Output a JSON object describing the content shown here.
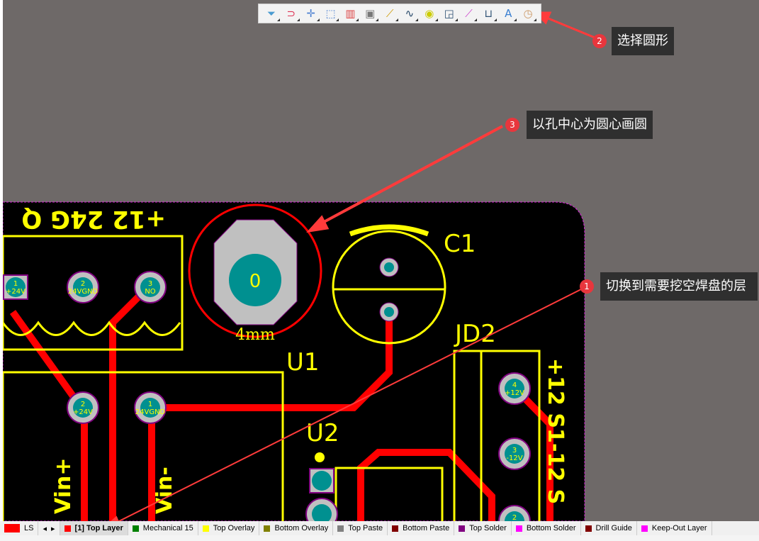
{
  "toolbar": {
    "items": [
      {
        "icon": "filter-icon",
        "glyph": "⏷",
        "color": "#4a9bd1"
      },
      {
        "icon": "magnet-icon",
        "glyph": "⊃",
        "color": "#d35"
      },
      {
        "icon": "move-icon",
        "glyph": "✛",
        "color": "#4a7fd1"
      },
      {
        "icon": "select-rect-icon",
        "glyph": "⬚",
        "color": "#4a7fd1"
      },
      {
        "icon": "align-icon",
        "glyph": "▥",
        "color": "#d44"
      },
      {
        "icon": "component-icon",
        "glyph": "▣",
        "color": "#777"
      },
      {
        "icon": "route-track-icon",
        "glyph": "⟋",
        "color": "#c90"
      },
      {
        "icon": "interactive-route-icon",
        "glyph": "∿",
        "color": "#246"
      },
      {
        "icon": "via-icon",
        "glyph": "◉",
        "color": "#cc0"
      },
      {
        "icon": "polygon-icon",
        "glyph": "◲",
        "color": "#357"
      },
      {
        "icon": "line-icon",
        "glyph": "⟋",
        "color": "#c4c"
      },
      {
        "icon": "dimension-icon",
        "glyph": "⊔",
        "color": "#357"
      },
      {
        "icon": "text-icon",
        "glyph": "A",
        "color": "#3a7fd1"
      },
      {
        "icon": "arc-circle-icon",
        "glyph": "◷",
        "color": "#c96"
      }
    ]
  },
  "callouts": [
    {
      "num": "2",
      "text": "选择圆形"
    },
    {
      "num": "3",
      "text": "以孔中心为圆心画圆"
    },
    {
      "num": "1",
      "text": "切换到需要挖空焊盘的层"
    }
  ],
  "pcb": {
    "designators": {
      "u1": "U1",
      "c1": "C1",
      "jd2": "JD2",
      "u2": "U2"
    },
    "hole_label": "0",
    "hole_size": "4mm",
    "connector_text": "+12 24G  Q",
    "pads": [
      {
        "num": "1",
        "net": "+24V"
      },
      {
        "num": "2",
        "net": "24VGND"
      },
      {
        "num": "3",
        "net": "NO"
      },
      {
        "num": "2",
        "net": "+24V"
      },
      {
        "num": "1",
        "net": "24VGND"
      },
      {
        "num": "2",
        "net": "+24V"
      },
      {
        "num": "1",
        "net": "24VGND"
      },
      {
        "num": "4",
        "net": "+12V"
      },
      {
        "num": "3",
        "net": "-12V"
      },
      {
        "num": "2",
        "net": ""
      }
    ],
    "vin_label": "Vin+",
    "vin_label2": "Vin-",
    "jd2_text1": "+12 S1",
    "jd2_text2": "-12 S"
  },
  "layers": {
    "current": {
      "label": "LS",
      "color": "#ff0000"
    },
    "tabs": [
      {
        "label": "[1] Top Layer",
        "color": "#ff0000",
        "active": true
      },
      {
        "label": "Mechanical 15",
        "color": "#008000"
      },
      {
        "label": "Top Overlay",
        "color": "#ffff00"
      },
      {
        "label": "Bottom Overlay",
        "color": "#808000"
      },
      {
        "label": "Top Paste",
        "color": "#808080"
      },
      {
        "label": "Bottom Paste",
        "color": "#800000"
      },
      {
        "label": "Top Solder",
        "color": "#800080"
      },
      {
        "label": "Bottom Solder",
        "color": "#ff00ff"
      },
      {
        "label": "Drill Guide",
        "color": "#800000"
      },
      {
        "label": "Keep-Out Layer",
        "color": "#ff00ff"
      }
    ]
  }
}
